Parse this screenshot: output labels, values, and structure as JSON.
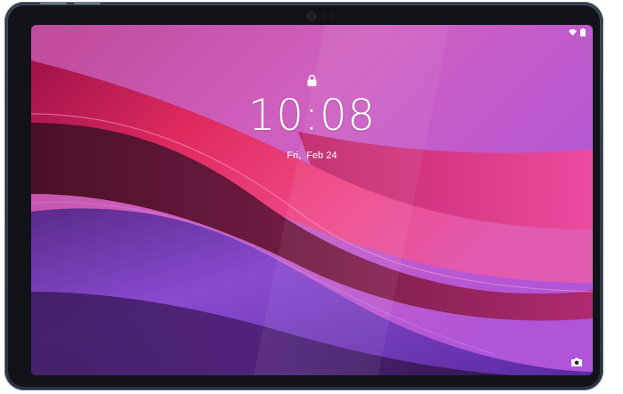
{
  "lock_screen": {
    "time": "10:08",
    "day": "Fri,",
    "date": "Feb 24"
  },
  "status_bar": {
    "icons": [
      "wifi-icon",
      "battery-icon"
    ]
  },
  "shortcuts": {
    "bottom_right": "camera-icon",
    "top_center": "lock-icon"
  },
  "colors": {
    "bezel": "#3d4a5a",
    "wallpaper_primary": "#e0307a",
    "wallpaper_secondary": "#7a3fc0",
    "wallpaper_dark": "#3a1a3a"
  }
}
